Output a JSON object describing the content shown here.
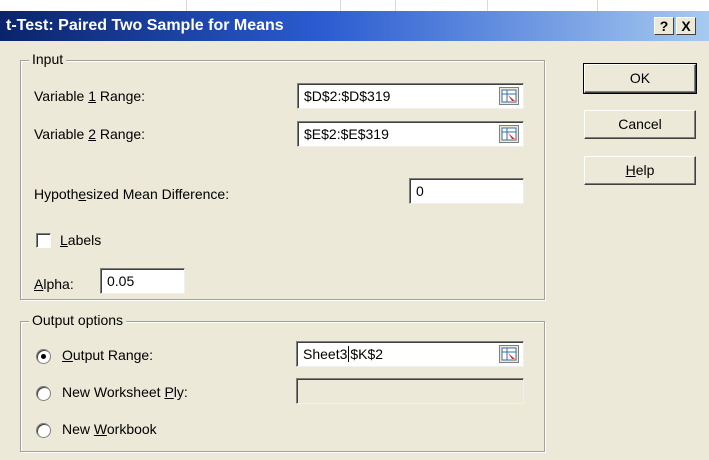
{
  "window": {
    "title": "t-Test: Paired Two Sample for Means",
    "help_btn": "?",
    "close_btn": "X"
  },
  "input_group": {
    "title": "Input",
    "var1_pre": "Variable ",
    "var1_key": "1",
    "var1_post": " Range:",
    "var1_value": "$D$2:$D$319",
    "var2_pre": "Variable ",
    "var2_key": "2",
    "var2_post": " Range:",
    "var2_value": "$E$2:$E$319",
    "hmd_pre": "Hypoth",
    "hmd_key": "e",
    "hmd_post": "sized Mean Difference:",
    "hmd_value": "0",
    "labels_key": "L",
    "labels_post": "abels",
    "labels_checked": false,
    "alpha_key": "A",
    "alpha_post": "lpha:",
    "alpha_value": "0.05"
  },
  "output_group": {
    "title": "Output options",
    "range_key": "O",
    "range_post": "utput Range:",
    "range_value_a": "Sheet3",
    "range_value_b": "$K$2",
    "ply_pre": "New Worksheet ",
    "ply_key": "P",
    "ply_post": "ly:",
    "ply_value": "",
    "wb_pre": "New ",
    "wb_key": "W",
    "wb_post": "orkbook",
    "selected": "output_range"
  },
  "buttons": {
    "ok": "OK",
    "cancel": "Cancel",
    "help_key": "H",
    "help_post": "elp"
  },
  "icons": {
    "refedit": "collapse-dialog-icon"
  }
}
